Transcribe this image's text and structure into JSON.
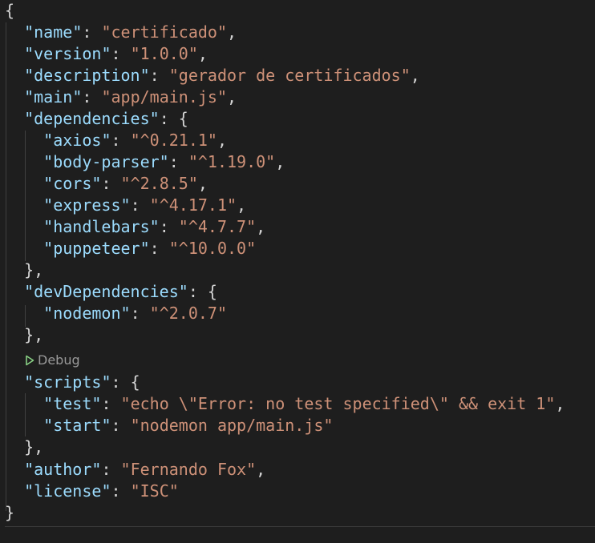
{
  "editor": {
    "language": "json",
    "file": {
      "name_key": "name",
      "name_value": "certificado",
      "version_key": "version",
      "version_value": "1.0.0",
      "description_key": "description",
      "description_value": "gerador de certificados",
      "main_key": "main",
      "main_value": "app/main.js",
      "dependencies_key": "dependencies",
      "dependencies": [
        {
          "key": "axios",
          "value": "^0.21.1"
        },
        {
          "key": "body-parser",
          "value": "^1.19.0"
        },
        {
          "key": "cors",
          "value": "^2.8.5"
        },
        {
          "key": "express",
          "value": "^4.17.1"
        },
        {
          "key": "handlebars",
          "value": "^4.7.7"
        },
        {
          "key": "puppeteer",
          "value": "^10.0.0"
        }
      ],
      "devDependencies_key": "devDependencies",
      "devDependencies": [
        {
          "key": "nodemon",
          "value": "^2.0.7"
        }
      ],
      "scripts_key": "scripts",
      "scripts": [
        {
          "key": "test",
          "value": "echo \\\"Error: no test specified\\\" && exit 1"
        },
        {
          "key": "start",
          "value": "nodemon app/main.js"
        }
      ],
      "author_key": "author",
      "author_value": "Fernando Fox",
      "license_key": "license",
      "license_value": "ISC"
    },
    "codelens": {
      "label": "Debug",
      "icon": "play-icon"
    },
    "colors": {
      "background": "#1e1e1e",
      "key": "#9cdcfe",
      "string": "#ce9178",
      "punctuation": "#d4d4d4",
      "debug_icon": "#89d185"
    }
  }
}
